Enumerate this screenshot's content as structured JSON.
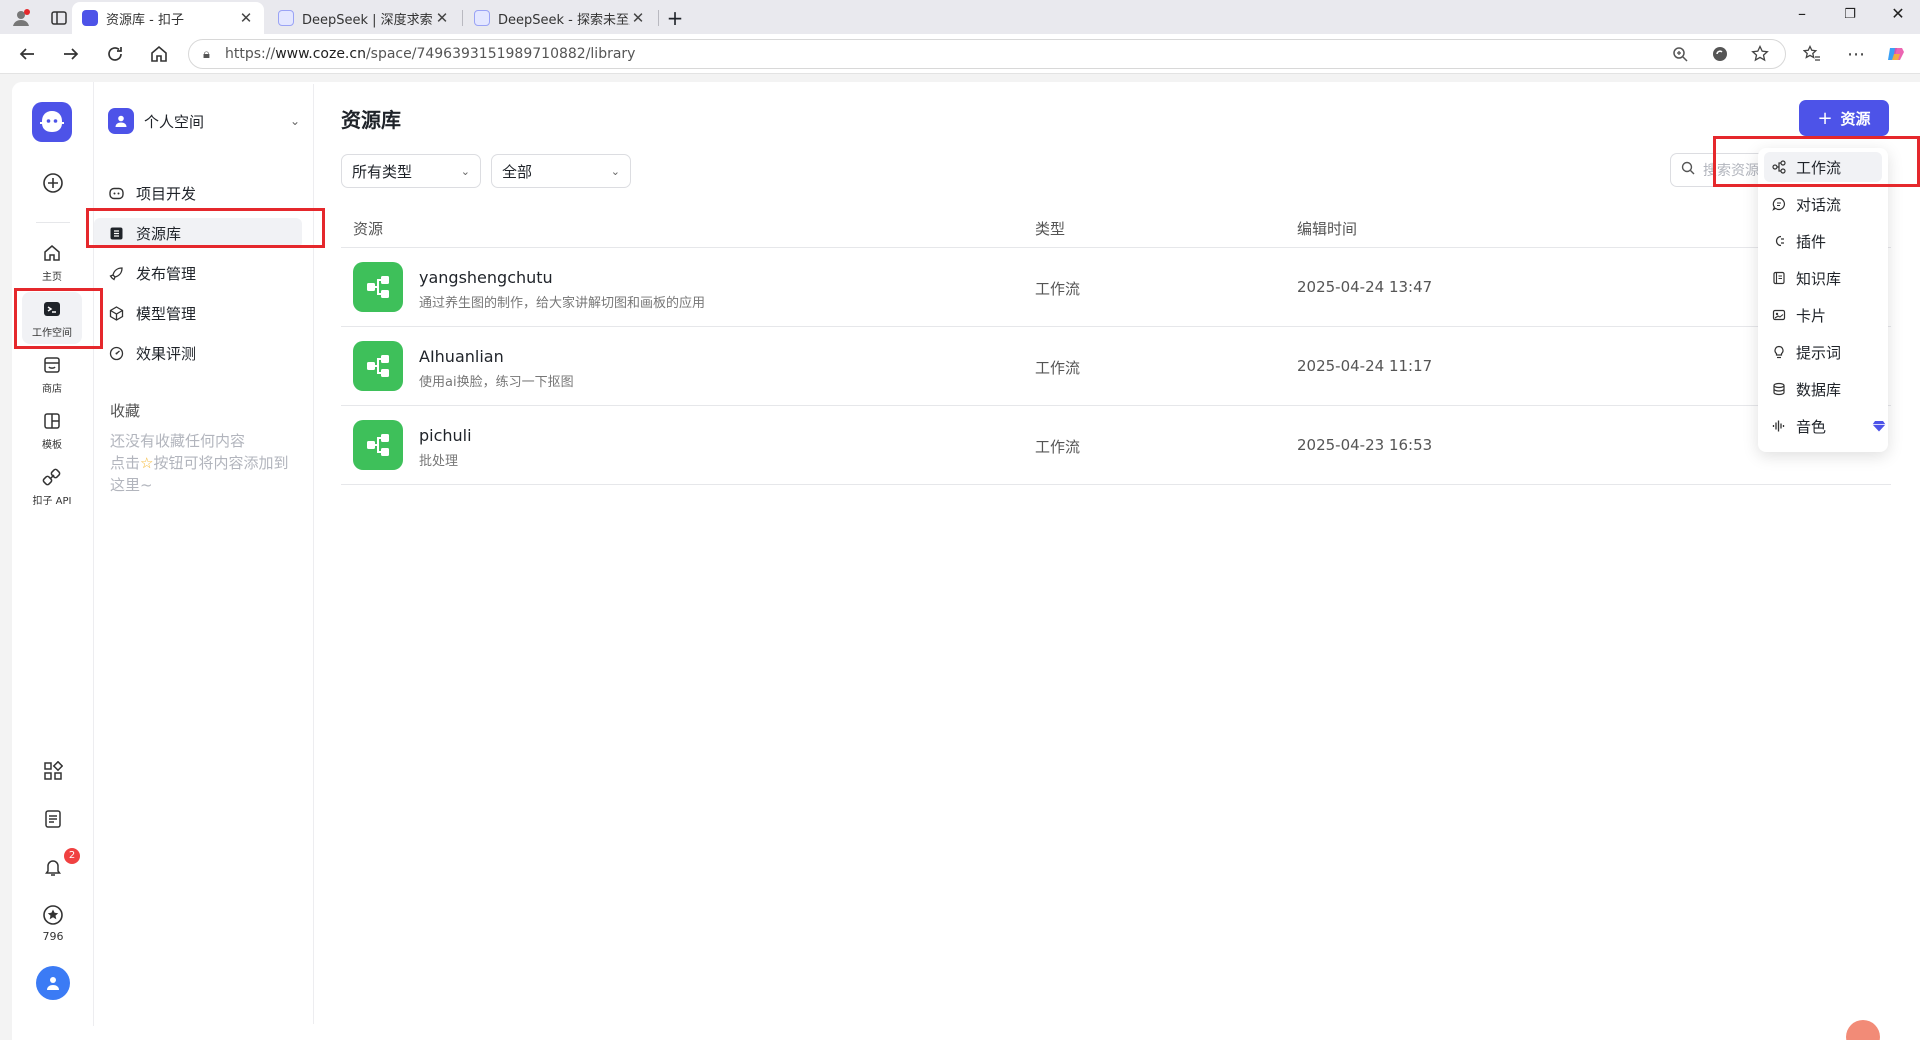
{
  "browser": {
    "tabs": [
      {
        "title": "资源库 - 扣子",
        "active": true
      },
      {
        "title": "DeepSeek | 深度求索",
        "active": false
      },
      {
        "title": "DeepSeek - 探索未至之境",
        "active": false
      }
    ],
    "new_tab": "+",
    "url_prefix": "https://",
    "url_host": "www.coze.cn",
    "url_path": "/space/7496393151989710882/library",
    "window_controls": [
      "–",
      "❐",
      "✕"
    ]
  },
  "rail": {
    "items": [
      {
        "label": "主页",
        "icon": "home-icon"
      },
      {
        "label": "工作空间",
        "icon": "workspace-icon"
      },
      {
        "label": "商店",
        "icon": "store-icon"
      },
      {
        "label": "模板",
        "icon": "template-icon"
      },
      {
        "label": "扣子 API",
        "icon": "api-icon"
      }
    ],
    "notification_count": "2",
    "points": "796"
  },
  "subnav": {
    "space_name": "个人空间",
    "items": [
      {
        "label": "项目开发",
        "icon": "project-icon"
      },
      {
        "label": "资源库",
        "icon": "library-icon"
      },
      {
        "label": "发布管理",
        "icon": "rocket-icon"
      },
      {
        "label": "模型管理",
        "icon": "model-icon"
      },
      {
        "label": "效果评测",
        "icon": "evaluation-icon"
      }
    ],
    "favorites_title": "收藏",
    "favorites_empty_1": "还没有收藏任何内容",
    "favorites_empty_2a": "点击",
    "favorites_empty_2b": "按钮可将内容添加到",
    "favorites_empty_3": "这里~"
  },
  "main": {
    "title": "资源库",
    "add_button": "资源",
    "filter_type": "所有类型",
    "filter_scope": "全部",
    "search_placeholder": "搜索资源",
    "columns": [
      "资源",
      "类型",
      "编辑时间"
    ],
    "rows": [
      {
        "name": "yangshengchutu",
        "desc": "通过养生图的制作，给大家讲解切图和画板的应用",
        "type": "工作流",
        "time": "2025-04-24 13:47"
      },
      {
        "name": "AIhuanlian",
        "desc": "使用ai换脸，练习一下抠图",
        "type": "工作流",
        "time": "2025-04-24 11:17"
      },
      {
        "name": "pichuli",
        "desc": "批处理",
        "type": "工作流",
        "time": "2025-04-23 16:53"
      }
    ]
  },
  "dropdown": {
    "items": [
      {
        "label": "工作流",
        "icon": "workflow-icon"
      },
      {
        "label": "对话流",
        "icon": "chatflow-icon"
      },
      {
        "label": "插件",
        "icon": "plugin-icon"
      },
      {
        "label": "知识库",
        "icon": "knowledge-icon"
      },
      {
        "label": "卡片",
        "icon": "card-icon"
      },
      {
        "label": "提示词",
        "icon": "prompt-icon"
      },
      {
        "label": "数据库",
        "icon": "database-icon"
      },
      {
        "label": "音色",
        "icon": "voice-icon"
      }
    ]
  },
  "colors": {
    "brand": "#4d53e8",
    "resource_icon": "#3ec05a",
    "highlight": "#e5282c"
  }
}
